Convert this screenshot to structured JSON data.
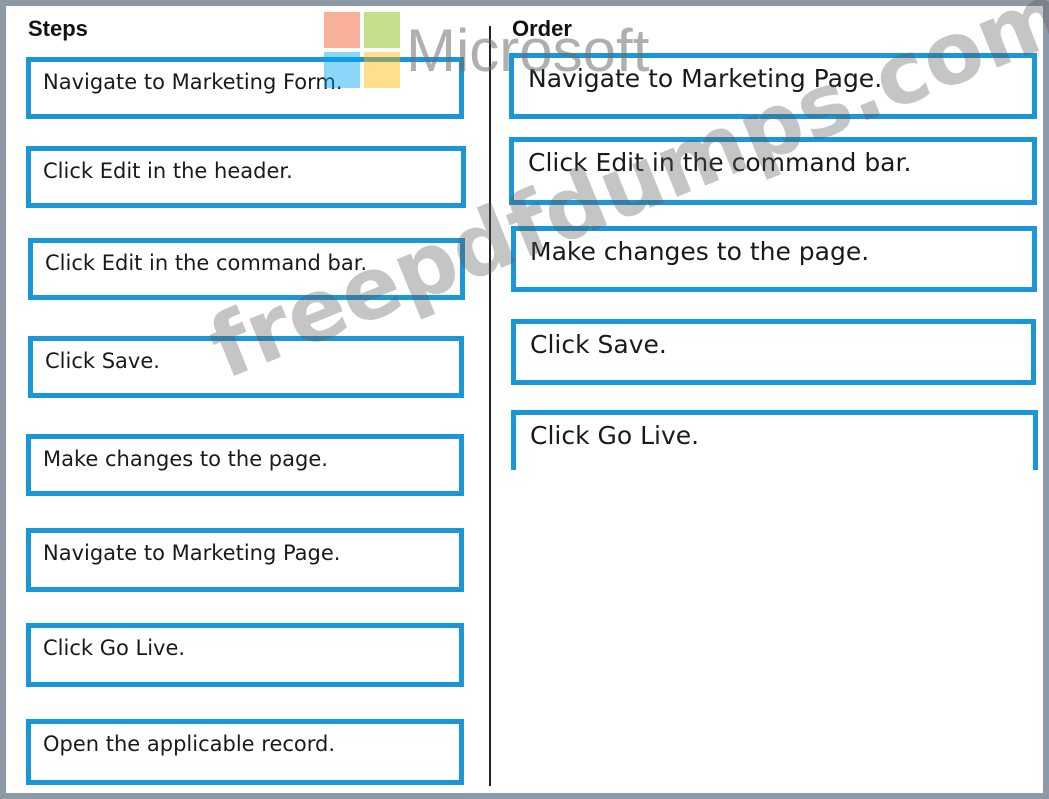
{
  "headings": {
    "steps": "Steps",
    "order": "Order"
  },
  "steps": [
    "Navigate to Marketing Form.",
    "Click Edit in the header.",
    "Click Edit in the command bar.",
    "Click Save.",
    "Make changes to the page.",
    "Navigate to Marketing Page.",
    "Click Go Live.",
    "Open the applicable record."
  ],
  "order": [
    "Navigate to Marketing Page.",
    "Click Edit in the command bar.",
    "Make changes to the page.",
    "Click Save.",
    "Click Go Live."
  ],
  "watermark": {
    "logo_text": "Microsoft",
    "site_text": "freepdfdumps.com"
  },
  "colors": {
    "box_border": "#1b97d6",
    "frame_border": "#8c9aa8",
    "logo_red": "#f25022",
    "logo_green": "#7fba00",
    "logo_blue": "#00a4ef",
    "logo_yellow": "#ffb900"
  }
}
